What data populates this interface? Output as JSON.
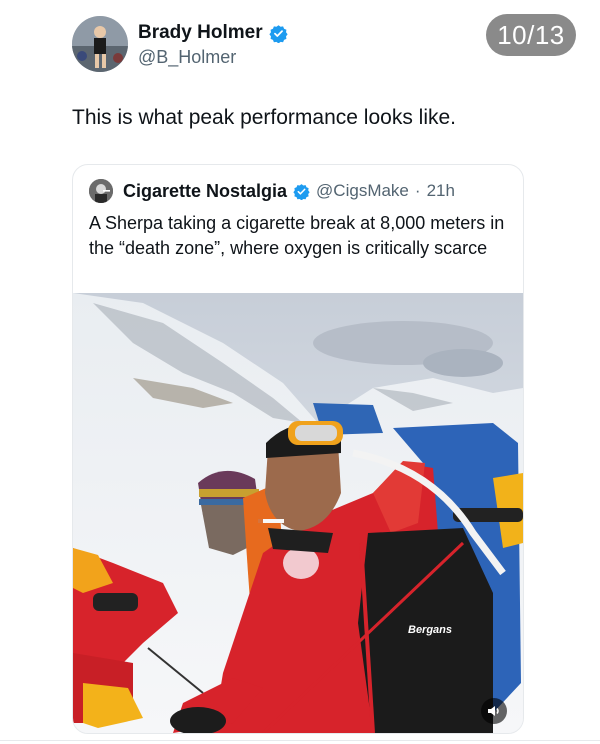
{
  "tweet": {
    "author_name": "Brady Holmer",
    "author_handle": "@B_Holmer",
    "text": "This is what peak performance looks like.",
    "avatar_icon": "runner-avatar"
  },
  "pager": {
    "label": "10/13"
  },
  "quoted_tweet": {
    "author_name": "Cigarette Nostalgia",
    "author_handle": "@CigsMake",
    "separator": "·",
    "time": "21h",
    "text": "A Sherpa taking a cigarette break at 8,000 meters in the “death zone”, where oxygen is critically scarce",
    "media": {
      "brand_text": "Bergans",
      "sound_icon": "speaker-icon"
    }
  },
  "colors": {
    "verified": "#1d9bf0",
    "jacket_red": "#d7232b",
    "pager_bg": "#8a8a8a",
    "secondary_text": "#536471"
  }
}
